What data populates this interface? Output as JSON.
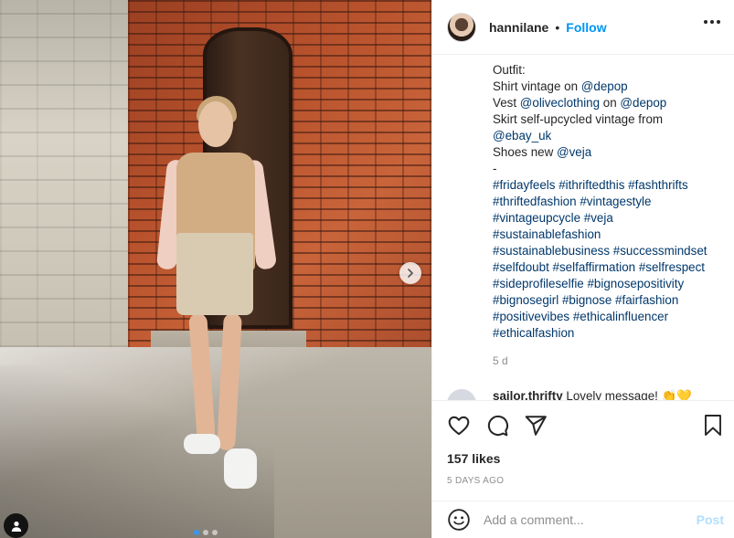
{
  "post": {
    "username": "hannilane",
    "separator": "•",
    "follow_label": "Follow",
    "caption_lines": [
      [
        {
          "t": "Outfit:"
        }
      ],
      [
        {
          "t": "Shirt vintage on "
        },
        {
          "t": "@depop",
          "tag": true
        }
      ],
      [
        {
          "t": "Vest "
        },
        {
          "t": "@oliveclothing",
          "tag": true
        },
        {
          "t": " on "
        },
        {
          "t": "@depop",
          "tag": true
        }
      ],
      [
        {
          "t": "Skirt self-upcycled vintage from"
        }
      ],
      [
        {
          "t": "@ebay_uk",
          "tag": true
        }
      ],
      [
        {
          "t": "Shoes new "
        },
        {
          "t": "@veja",
          "tag": true
        }
      ],
      [
        {
          "t": "-"
        }
      ],
      [
        {
          "t": "#fridayfeels",
          "tag": true
        },
        {
          "t": " "
        },
        {
          "t": "#ithriftedthis",
          "tag": true
        },
        {
          "t": " "
        },
        {
          "t": "#fashthrifts",
          "tag": true
        }
      ],
      [
        {
          "t": "#thriftedfashion",
          "tag": true
        },
        {
          "t": " "
        },
        {
          "t": "#vintagestyle",
          "tag": true
        }
      ],
      [
        {
          "t": "#vintageupcycle",
          "tag": true
        },
        {
          "t": " "
        },
        {
          "t": "#veja",
          "tag": true
        }
      ],
      [
        {
          "t": "#sustainablefashion",
          "tag": true
        }
      ],
      [
        {
          "t": "#sustainablebusiness",
          "tag": true
        },
        {
          "t": " "
        },
        {
          "t": "#successmindset",
          "tag": true
        }
      ],
      [
        {
          "t": "#selfdoubt",
          "tag": true
        },
        {
          "t": " "
        },
        {
          "t": "#selfaffirmation",
          "tag": true
        },
        {
          "t": " "
        },
        {
          "t": "#selfrespect",
          "tag": true
        }
      ],
      [
        {
          "t": "#sideprofileselfie",
          "tag": true
        },
        {
          "t": " "
        },
        {
          "t": "#bignosepositivity",
          "tag": true
        }
      ],
      [
        {
          "t": "#bignosegirl",
          "tag": true
        },
        {
          "t": " "
        },
        {
          "t": "#bignose",
          "tag": true
        },
        {
          "t": " "
        },
        {
          "t": "#fairfashion",
          "tag": true
        }
      ],
      [
        {
          "t": "#positivevibes",
          "tag": true
        },
        {
          "t": " "
        },
        {
          "t": "#ethicalinfluencer",
          "tag": true
        }
      ],
      [
        {
          "t": "#ethicalfashion",
          "tag": true
        }
      ]
    ],
    "caption_age": "5 d",
    "first_comment": {
      "user": "sailor.thrifty",
      "text": " Lovely message! 👏💛"
    },
    "likes": "157 likes",
    "date": "5 DAYS AGO",
    "comment_placeholder": "Add a comment...",
    "post_label": "Post"
  },
  "colors": {
    "link": "#00376b",
    "follow": "#0095f6",
    "post_disabled": "#b2dffc",
    "carousel_active": "#3897f0"
  },
  "icons": [
    "chevron-right-icon",
    "user-tag-icon",
    "more-options-icon",
    "heart-icon",
    "comment-icon",
    "share-icon",
    "bookmark-icon",
    "emoji-icon"
  ],
  "carousel": {
    "count": 3,
    "active": 0
  }
}
